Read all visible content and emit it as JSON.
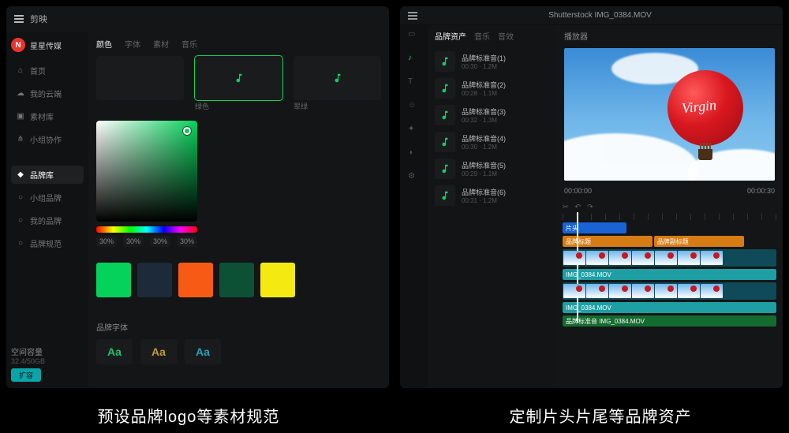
{
  "captions": {
    "left": "预设品牌logo等素材规范",
    "right": "定制片头片尾等品牌资产"
  },
  "left": {
    "app_name": "剪映",
    "user": {
      "initial": "N",
      "name": "星星传媒"
    },
    "nav": {
      "items": [
        "首页",
        "我的云端",
        "素材库",
        "小组协作"
      ],
      "active_group_label": "品牌库",
      "sub": [
        "小组品牌",
        "我的品牌",
        "品牌规范"
      ]
    },
    "bottom": {
      "label": "空间容量",
      "detail": "32.4/50GB",
      "chip": "扩容"
    },
    "tabs": [
      "颜色",
      "字体",
      "素材",
      "音乐"
    ],
    "thumbs": [
      "绿色",
      "翠绿"
    ],
    "percents": [
      "30%",
      "30%",
      "30%",
      "30%"
    ],
    "swatches": [
      "#05d25a",
      "#1c2a3a",
      "#f65a14",
      "#0c5136",
      "#f4ea12"
    ],
    "font_section_title": "品牌字体",
    "font_styles": [
      {
        "label": "Aa",
        "color": "#23c06a"
      },
      {
        "label": "Aa",
        "color": "#c29a3a"
      },
      {
        "label": "Aa",
        "color": "#2aa0b8"
      }
    ]
  },
  "right": {
    "title": "Shutterstock IMG_0384.MOV",
    "iconcol": [
      "media",
      "audio",
      "text",
      "sticker",
      "fx",
      "filter",
      "adjust"
    ],
    "assets_head": [
      "品牌资产",
      "音乐",
      "音效"
    ],
    "assets": [
      {
        "name": "品牌标准音(1)",
        "sub": "00:30 · 1.2M"
      },
      {
        "name": "品牌标准音(2)",
        "sub": "00:28 · 1.1M"
      },
      {
        "name": "品牌标准音(3)",
        "sub": "00:32 · 1.3M"
      },
      {
        "name": "品牌标准音(4)",
        "sub": "00:30 · 1.2M"
      },
      {
        "name": "品牌标准音(5)",
        "sub": "00:29 · 1.1M"
      },
      {
        "name": "品牌标准音(6)",
        "sub": "00:31 · 1.2M"
      }
    ],
    "preview_head": "播放器",
    "balloon_logo": "Virgin",
    "time": {
      "current": "00:00:00",
      "total": "00:00:30"
    },
    "tracks": {
      "t1": {
        "bg": "#1963d6",
        "label": "片头"
      },
      "t2a": {
        "bg": "#d67c14",
        "label": "品牌标题"
      },
      "t2b": {
        "bg": "#d67c14",
        "label": "品牌副标题"
      },
      "t3": {
        "bg": "#1d9fa3",
        "label": "IMG_0384.MOV"
      },
      "t4": {
        "bg": "#1d9fa3",
        "label": "IMG_0384.MOV"
      },
      "audio": {
        "bg": "#146b2f",
        "label": "品牌标准音 IMG_0384.MOV"
      }
    }
  }
}
